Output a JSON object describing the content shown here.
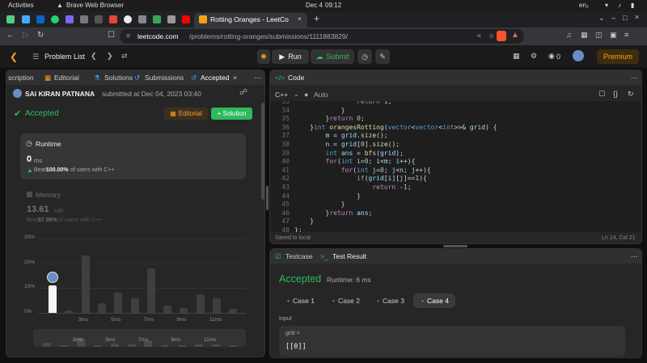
{
  "os": {
    "activities": "Activities",
    "browser": "Brave Web Browser",
    "date": "Dec 4",
    "time": "09:12",
    "lang": "en₂"
  },
  "browser": {
    "tab_title": "Rotting Oranges - LeetCo",
    "url_host": "leetcode.com",
    "url_path": "/problems/rotting-oranges/submissions/1111883829/"
  },
  "header": {
    "problem_list": "Problem List",
    "run": "Run",
    "submit": "Submit",
    "streak": "0",
    "premium": "Premium"
  },
  "left": {
    "tabs": [
      "scription",
      "Editorial",
      "Solutions",
      "Submissions",
      "Accepted"
    ],
    "user": "SAI KIRAN PATNANA",
    "submitted": "submitted at Dec 04, 2023 03:40",
    "status": "Accepted",
    "editorial_btn": "Editorial",
    "solution_btn": "+ Solution",
    "runtime": {
      "title": "Runtime",
      "value": "0",
      "unit": "ms",
      "beats_label": "Beats",
      "beats_pct": "100.00%",
      "beats_suffix": "of users with C++"
    },
    "memory": {
      "title": "Memory",
      "value": "13.61",
      "unit": "MB",
      "beats_label": "Beats",
      "beats_pct": "37.96%",
      "beats_suffix": "of users with C++"
    }
  },
  "chart_data": {
    "type": "bar",
    "categories": [
      "0ms",
      "",
      "3ms",
      "",
      "5ms",
      "",
      "7ms",
      "",
      "9ms",
      "",
      "11ms",
      ""
    ],
    "values": [
      11,
      1,
      23,
      4,
      8,
      6,
      18,
      3,
      2,
      7.5,
      6,
      1.5
    ],
    "highlight_index": 0,
    "y_ticks": [
      "30%",
      "20%",
      "10%",
      "0%"
    ],
    "x_ticks": [
      "3ms",
      "5ms",
      "7ms",
      "9ms",
      "11ms"
    ],
    "ylim": [
      0,
      30
    ]
  },
  "code": {
    "title": "Code",
    "language": "C++",
    "mode": "Auto",
    "saved": "Saved to local",
    "cursor": "Ln 14, Col 21",
    "lines": [
      {
        "n": "33",
        "t": "                return 1;"
      },
      {
        "n": "34",
        "t": "            }"
      },
      {
        "n": "35",
        "t": "        }return 0;"
      },
      {
        "n": "36",
        "t": "    }int orangesRotting(vector<vector<int>>& grid) {"
      },
      {
        "n": "37",
        "t": "        m = grid.size();"
      },
      {
        "n": "38",
        "t": "        n = grid[0].size();"
      },
      {
        "n": "39",
        "t": "        int ans = bfs(grid);"
      },
      {
        "n": "40",
        "t": "        for(int i=0; i<m; i++){"
      },
      {
        "n": "41",
        "t": "            for(int j=0; j<n; j++){"
      },
      {
        "n": "42",
        "t": "                if(grid[i][j]==1){"
      },
      {
        "n": "43",
        "t": "                    return -1;"
      },
      {
        "n": "44",
        "t": "                }"
      },
      {
        "n": "45",
        "t": "            }"
      },
      {
        "n": "46",
        "t": "        }return ans;"
      },
      {
        "n": "47",
        "t": "    }"
      },
      {
        "n": "48",
        "t": "};"
      }
    ]
  },
  "result": {
    "tab_testcase": "Testcase",
    "tab_result": "Test Result",
    "status": "Accepted",
    "runtime": "Runtime: 6 ms",
    "cases": [
      "Case 1",
      "Case 2",
      "Case 3",
      "Case 4"
    ],
    "active_case": 3,
    "input_label": "Input",
    "var_name": "grid =",
    "var_value": "[[0]]"
  }
}
